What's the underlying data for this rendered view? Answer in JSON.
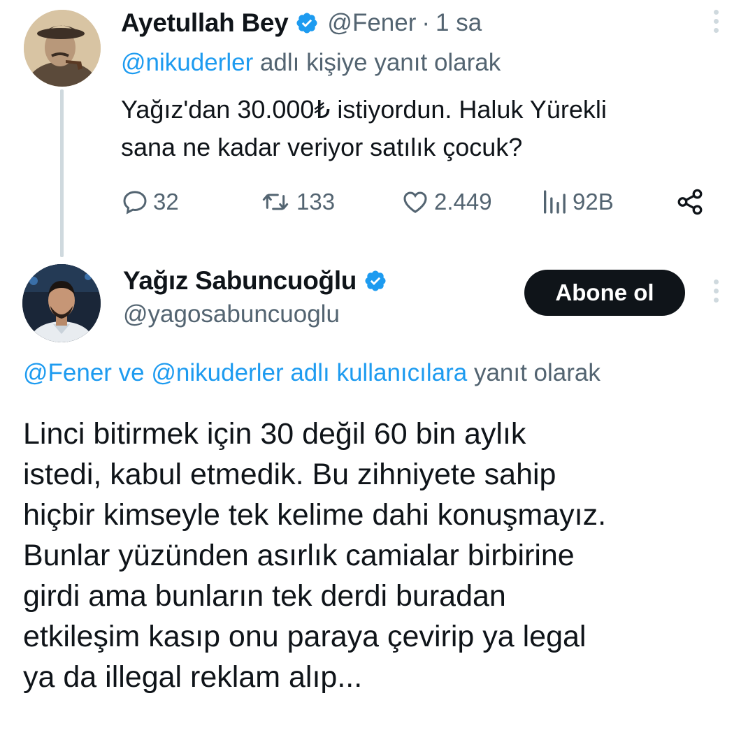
{
  "tweet1": {
    "author_name": "Ayetullah Bey",
    "handle": "@Fener",
    "separator": "·",
    "time": "1 sa",
    "reply_mention": "@nikuderler",
    "reply_suffix": " adlı kişiye yanıt olarak",
    "body_line1": "Yağız'dan 30.000₺ istiyordun. Haluk Yürekli",
    "body_line2": "sana ne kadar veriyor satılık çocuk?",
    "replies": "32",
    "retweets": "133",
    "likes": "2.449",
    "views": "92B"
  },
  "tweet2": {
    "author_name": "Yağız Sabuncuoğlu",
    "handle": "@yagosabuncuoglu",
    "follow_label": "Abone ol",
    "reply_mentions": "@Fener ve @nikuderler adlı kullanıcılara",
    "reply_suffix": " yanıt olarak",
    "body_lines": [
      "Linci bitirmek için 30 değil 60 bin aylık",
      "istedi, kabul etmedik. Bu zihniyete sahip",
      "hiçbir kimseyle tek kelime dahi konuşmayız.",
      "Bunlar yüzünden asırlık camialar birbirine",
      "girdi ama bunların tek derdi buradan",
      "etkileşim kasıp onu paraya çevirip ya legal",
      "ya da illegal reklam alıp..."
    ]
  },
  "icons": {
    "verified": "verified-badge-icon",
    "reply": "reply-bubble-icon",
    "retweet": "retweet-icon",
    "like": "heart-icon",
    "views": "views-bars-icon",
    "share": "share-icon",
    "more": "more-options-icon"
  },
  "colors": {
    "accent": "#1d9bf0",
    "text": "#0f1419",
    "secondary": "#536471",
    "button_bg": "#0f1419"
  }
}
